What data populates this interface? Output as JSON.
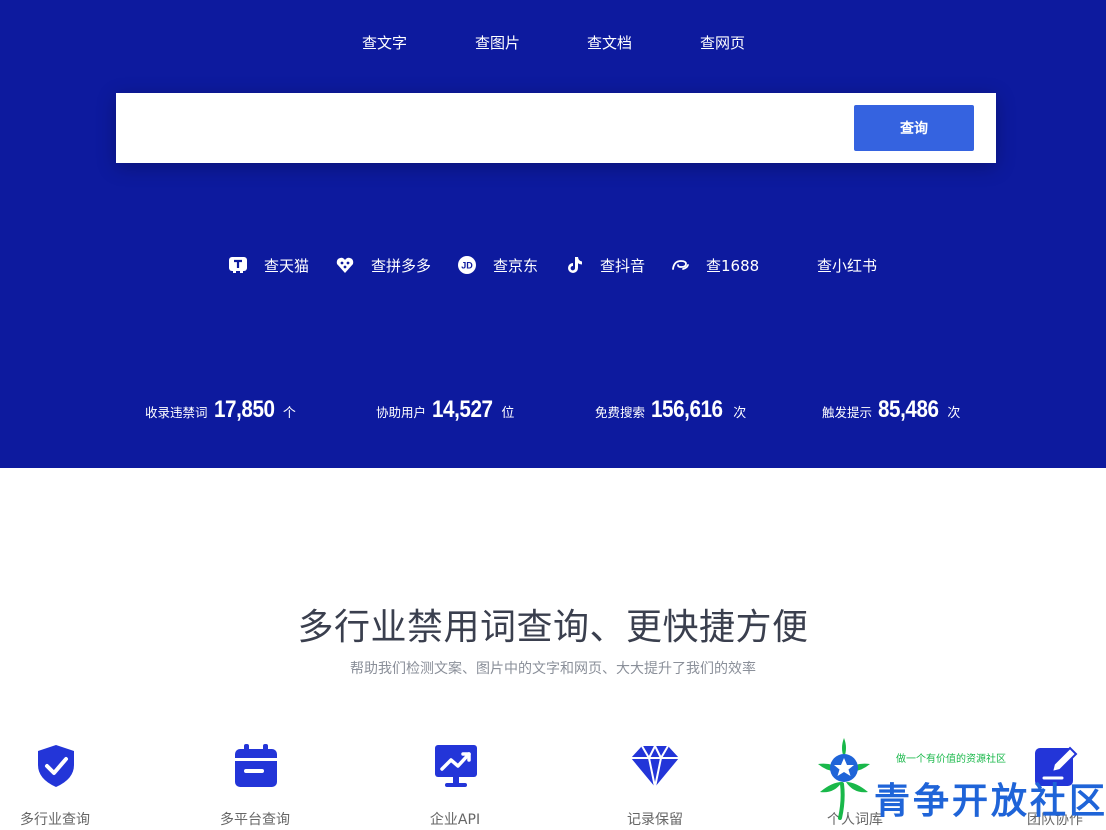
{
  "search_tabs": [
    {
      "label": "查文字"
    },
    {
      "label": "查图片"
    },
    {
      "label": "查文档"
    },
    {
      "label": "查网页"
    }
  ],
  "search": {
    "value": "",
    "button_label": "查询"
  },
  "platforms": [
    {
      "label": "查天猫",
      "icon": "tmall-icon"
    },
    {
      "label": "查拼多多",
      "icon": "pinduoduo-icon"
    },
    {
      "label": "查京东",
      "icon": "jd-icon"
    },
    {
      "label": "查抖音",
      "icon": "douyin-icon"
    },
    {
      "label": "查1688",
      "icon": "alibaba-1688-icon"
    },
    {
      "label": "查小红书",
      "icon": "xiaohongshu-icon"
    }
  ],
  "stats": [
    {
      "label": "收录违禁词",
      "value": "17,850",
      "unit": "个"
    },
    {
      "label": "协助用户",
      "value": "14,527",
      "unit": "位"
    },
    {
      "label": "免费搜索",
      "value": "156,616",
      "unit": "次"
    },
    {
      "label": "触发提示",
      "value": "85,486",
      "unit": "次"
    }
  ],
  "section": {
    "title": "多行业禁用词查询、更快捷方便",
    "subtitle": "帮助我们检测文案、图片中的文字和网页、大大提升了我们的效率"
  },
  "features": [
    {
      "label": "多行业查询",
      "icon": "shield-check-icon"
    },
    {
      "label": "多平台查询",
      "icon": "calendar-icon"
    },
    {
      "label": "企业API",
      "icon": "trend-monitor-icon"
    },
    {
      "label": "记录保留",
      "icon": "diamond-icon"
    },
    {
      "label": "个人词库",
      "icon": "star-badge-icon"
    },
    {
      "label": "团队协作",
      "icon": "edit-icon"
    }
  ],
  "watermark": {
    "tagline": "做一个有价值的资源社区",
    "name": "青争开放社区"
  },
  "colors": {
    "hero_background": "#0d1a9e",
    "search_button": "#3563e0",
    "feature_icon": "#2335d8",
    "headline": "#3a3f4e",
    "watermark_green": "#19b84a",
    "watermark_blue": "#1f64d8"
  }
}
